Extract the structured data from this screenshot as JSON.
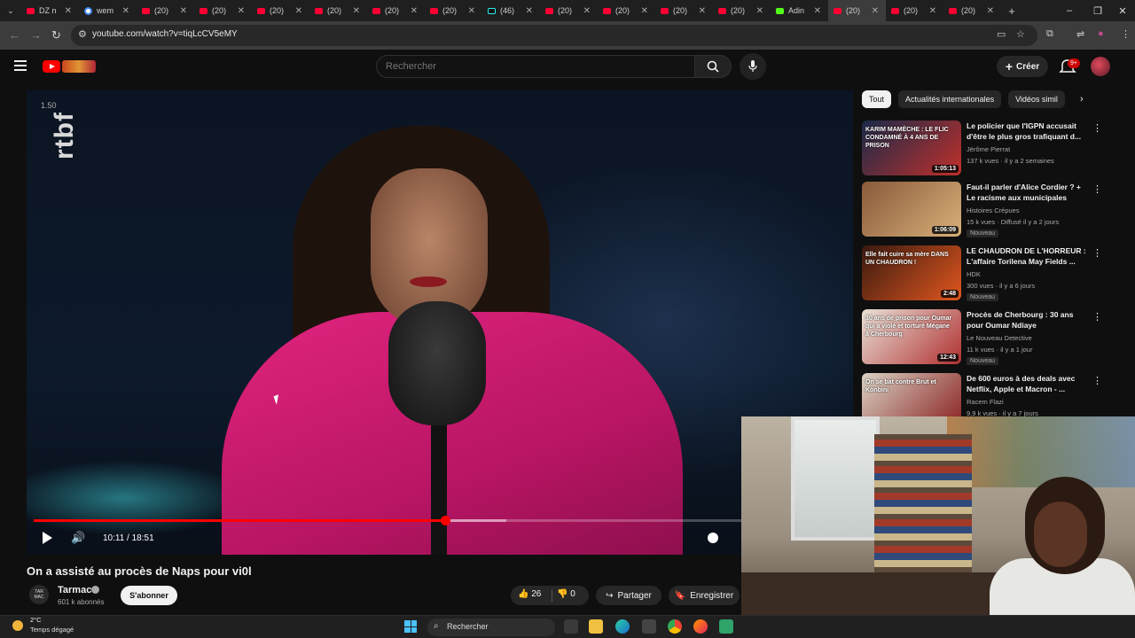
{
  "browser": {
    "tabs": [
      {
        "label": "DZ n",
        "icon": "youtube-icon",
        "active": false
      },
      {
        "label": "wem",
        "icon": "google-icon",
        "active": false
      },
      {
        "label": "(20)",
        "icon": "youtube-icon",
        "active": false
      },
      {
        "label": "(20)",
        "icon": "youtube-icon",
        "active": false
      },
      {
        "label": "(20)",
        "icon": "youtube-icon",
        "active": false
      },
      {
        "label": "(20)",
        "icon": "youtube-icon",
        "active": false
      },
      {
        "label": "(20)",
        "icon": "youtube-icon",
        "active": false
      },
      {
        "label": "(20)",
        "icon": "youtube-icon",
        "active": false
      },
      {
        "label": "(46)",
        "icon": "tiktok-icon",
        "active": false
      },
      {
        "label": "(20)",
        "icon": "youtube-icon",
        "active": false
      },
      {
        "label": "(20)",
        "icon": "youtube-icon",
        "active": false
      },
      {
        "label": "(20)",
        "icon": "youtube-icon",
        "active": false
      },
      {
        "label": "(20)",
        "icon": "youtube-icon",
        "active": false
      },
      {
        "label": "Adin",
        "icon": "kick-icon",
        "active": false
      },
      {
        "label": "(20)",
        "icon": "youtube-icon",
        "active": true
      },
      {
        "label": "(20)",
        "icon": "youtube-icon",
        "active": false
      },
      {
        "label": "(20)",
        "icon": "youtube-icon",
        "active": false
      }
    ],
    "url": "youtube.com/watch?v=tiqLcCV5eMY"
  },
  "youtube": {
    "search_placeholder": "Rechercher",
    "create_label": "Créer",
    "notification_count": "9+"
  },
  "player": {
    "speed_label": "1.50",
    "watermark": "rtbf",
    "time_display": "10:11 / 18:51",
    "progress": 0.54,
    "buffered": 0.62
  },
  "video": {
    "title": "On a assisté au procès de Naps pour vi0l",
    "channel_name": "Tarmac",
    "channel_avatar_text": "TAR MAC",
    "subscribers": "601 k abonnés",
    "subscribe_label": "S'abonner",
    "likes": "26",
    "dislikes": "0",
    "share_label": "Partager",
    "save_label": "Enregistrer"
  },
  "sidebar": {
    "chips": [
      "Tout",
      "Actualités internationales",
      "Vidéos simil"
    ],
    "recommendations": [
      {
        "title": "Le policier que l'IGPN accusait d'être le plus gros trafiquant d...",
        "channel": "Jérôme Pierrat",
        "meta": "137 k vues · il y a 2 semaines",
        "duration": "1:05:13",
        "badge": "",
        "thumb_text": "KARIM MAMÈCHE : LE FLIC CONDAMNÉ À 4 ANS DE PRISON",
        "colors": [
          "#1b2a4a",
          "#c0302a"
        ]
      },
      {
        "title": "Faut-il parler d'Alice Cordier ? + Le racisme aux municipales",
        "channel": "Histoires Crépues",
        "meta": "15 k vues · Diffusé il y a 2 jours",
        "duration": "1:06:09",
        "badge": "Nouveau",
        "thumb_text": "",
        "colors": [
          "#8a5a3a",
          "#d8b07a"
        ]
      },
      {
        "title": "LE CHAUDRON DE L'HORREUR : L'affaire Torilena May Fields ...",
        "channel": "HDK",
        "meta": "300 vues · il y a 6 jours",
        "duration": "2:48",
        "badge": "Nouveau",
        "thumb_text": "Elle fait cuire sa mère DANS UN CHAUDRON !",
        "colors": [
          "#3a1a10",
          "#e0561e"
        ]
      },
      {
        "title": "Procès de Cherbourg : 30 ans pour Oumar Ndiaye",
        "channel": "Le Nouveau Detective",
        "meta": "11 k vues · il y a 1 jour",
        "duration": "12:43",
        "badge": "Nouveau",
        "thumb_text": "30 ans de prison pour Oumar qui a violé et torturé Mégane à Cherbourg",
        "colors": [
          "#e9e2d8",
          "#b03030"
        ]
      },
      {
        "title": "De 600 euros à des deals avec Netflix, Apple et Macron - ...",
        "channel": "Racem Flazi",
        "meta": "9,9 k vues · il y a 7 jours",
        "duration": "",
        "badge": "",
        "thumb_text": "On se bat contre Brut et Konbini",
        "colors": [
          "#d9d2c4",
          "#8a2020"
        ]
      }
    ]
  },
  "taskbar": {
    "temperature": "2°C",
    "weather_text": "Temps dégagé",
    "search_label": "Rechercher"
  }
}
